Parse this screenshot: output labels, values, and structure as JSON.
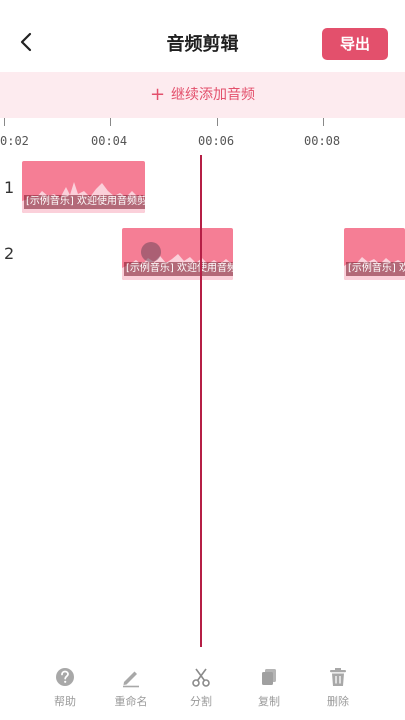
{
  "header": {
    "title": "音频剪辑",
    "export_label": "导出"
  },
  "add_bar": {
    "label": "继续添加音频"
  },
  "ruler": {
    "ticks": [
      "0:02",
      "00:04",
      "00:06",
      "00:08"
    ]
  },
  "tracks": [
    {
      "number": "1",
      "clips": [
        {
          "label": "[示例音乐] 欢迎使用音频剪"
        }
      ]
    },
    {
      "number": "2",
      "clips": [
        {
          "label": "[示例音乐] 欢迎使用音频剪"
        },
        {
          "label": "[示例音乐] 欢"
        }
      ]
    }
  ],
  "toolbar": {
    "items": [
      {
        "label": "帮助",
        "icon": "help-icon"
      },
      {
        "label": "重命名",
        "icon": "pencil-icon"
      },
      {
        "label": "分割",
        "icon": "scissors-icon"
      },
      {
        "label": "复制",
        "icon": "copy-icon"
      },
      {
        "label": "删除",
        "icon": "trash-icon"
      }
    ]
  },
  "colors": {
    "accent": "#e3506c",
    "clip": "#f57e95",
    "add_bar_bg": "#fdebef",
    "playhead": "#b51f45"
  }
}
